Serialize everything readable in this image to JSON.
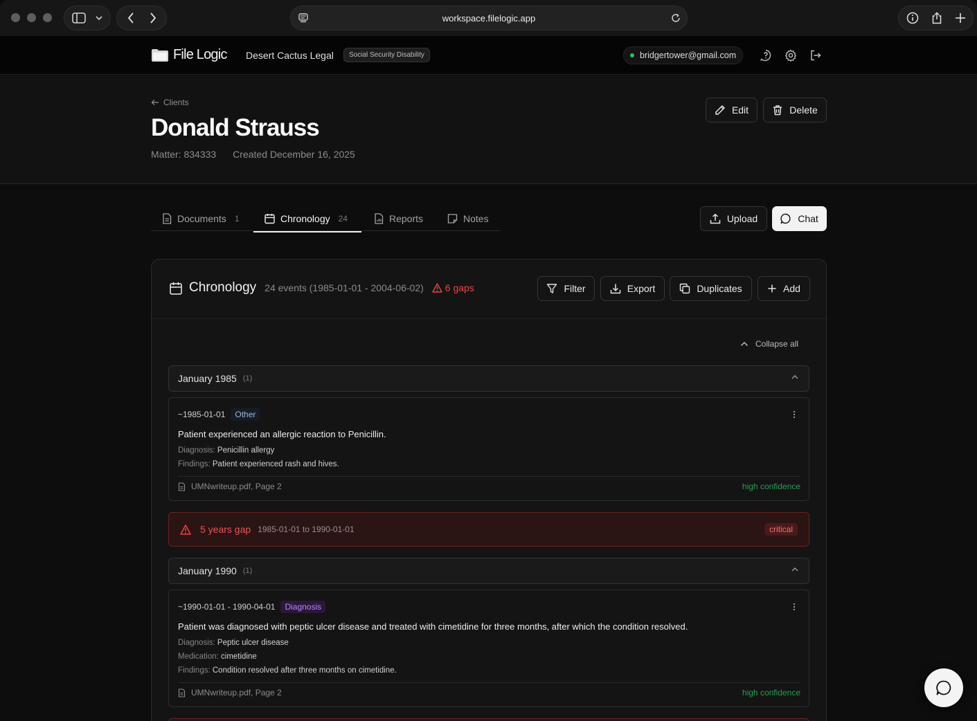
{
  "browser": {
    "url": "workspace.filelogic.app"
  },
  "app": {
    "logo_text": "File Logic",
    "org_name": "Desert Cactus Legal",
    "org_badge": "Social Security Disability",
    "user_email": "bridgertower@gmail.com"
  },
  "client": {
    "breadcrumb": "Clients",
    "name": "Donald Strauss",
    "matter": "Matter: 834333",
    "created": "Created December 16, 2025",
    "edit_label": "Edit",
    "delete_label": "Delete"
  },
  "tabs": [
    {
      "label": "Documents",
      "count": "1",
      "icon": "document-icon"
    },
    {
      "label": "Chronology",
      "count": "24",
      "icon": "calendar-icon",
      "active": true
    },
    {
      "label": "Reports",
      "count": "",
      "icon": "report-icon"
    },
    {
      "label": "Notes",
      "count": "",
      "icon": "note-icon"
    }
  ],
  "actions": {
    "upload_label": "Upload",
    "chat_label": "Chat"
  },
  "chronology": {
    "title": "Chronology",
    "summary": "24 events (1985-01-01 - 2004-06-02)",
    "gaps": "6 gaps",
    "filter_label": "Filter",
    "export_label": "Export",
    "duplicates_label": "Duplicates",
    "add_label": "Add",
    "collapse_all_label": "Collapse all",
    "groups": [
      {
        "month": "January 1985",
        "count": "(1)",
        "event": {
          "date": "~1985-01-01",
          "tag": "Other",
          "description": "Patient experienced an allergic reaction to Penicillin.",
          "fields": [
            {
              "key": "Diagnosis:",
              "value": "Penicillin allergy"
            },
            {
              "key": "Findings:",
              "value": "Patient experienced rash and hives."
            }
          ],
          "source": "UMNwriteup.pdf, Page 2",
          "confidence": "high confidence"
        }
      },
      {
        "month": "January 1990",
        "count": "(1)",
        "event": {
          "date": "~1990-01-01 - 1990-04-01",
          "tag": "Diagnosis",
          "description": "Patient was diagnosed with peptic ulcer disease and treated with cimetidine for three months, after which the condition resolved.",
          "fields": [
            {
              "key": "Diagnosis:",
              "value": "Peptic ulcer disease"
            },
            {
              "key": "Medication:",
              "value": "cimetidine"
            },
            {
              "key": "Findings:",
              "value": "Condition resolved after three months on cimetidine."
            }
          ],
          "source": "UMNwriteup.pdf, Page 2",
          "confidence": "high confidence"
        }
      }
    ],
    "gap": {
      "title": "5 years gap",
      "range": "1985-01-01 to 1990-01-01",
      "severity": "critical"
    }
  },
  "colors": {
    "accent_green": "#22c55e",
    "gap_red": "#ef4444",
    "diagnosis_purple": "#c084fc"
  }
}
